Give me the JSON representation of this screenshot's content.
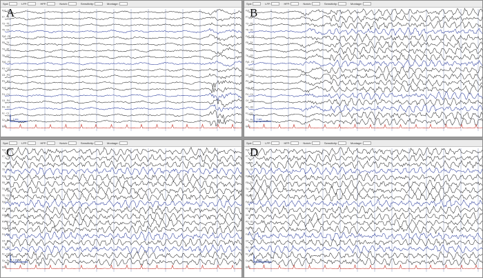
{
  "panels": [
    {
      "label": "A",
      "toolbar": [
        "Spd:",
        "LFF:",
        "HFF:",
        "Notch:",
        "Sensitivity:",
        "Montage:"
      ]
    },
    {
      "label": "B",
      "toolbar": [
        "Spd:",
        "LFF:",
        "HFF:",
        "Notch:",
        "Sensitivity:",
        "Montage:"
      ]
    },
    {
      "label": "C",
      "toolbar": [
        "Spd:",
        "LFF:",
        "HFF:",
        "Notch:",
        "Sensitivity:",
        "Montage:"
      ]
    },
    {
      "label": "D",
      "toolbar": [
        "Spd:",
        "LFF:",
        "HFF:",
        "Notch:",
        "Sensitivity:",
        "Montage:"
      ]
    }
  ],
  "channels": [
    "Fp1 - F7",
    "F7 - T3",
    "T3 - T5",
    "T5 - O1",
    "Fp2 - F8",
    "F8 - T4",
    "T4 - T6",
    "T6 - O2",
    "Fp1 - F3",
    "F3 - C3",
    "C3 - P3",
    "P3 - O1",
    "Fp2 - F4",
    "F4 - C4",
    "C4 - P4",
    "P4 - O2",
    "Fz - Cz",
    "Cz - Pz",
    "EKG"
  ],
  "colors": {
    "trace": "#2b2b2b",
    "trace_blue": "#2a3b9a",
    "ekg": "#c0261c",
    "grid": "#9aa3c8",
    "background": "#ffffff"
  },
  "scale_label": "1 sec"
}
